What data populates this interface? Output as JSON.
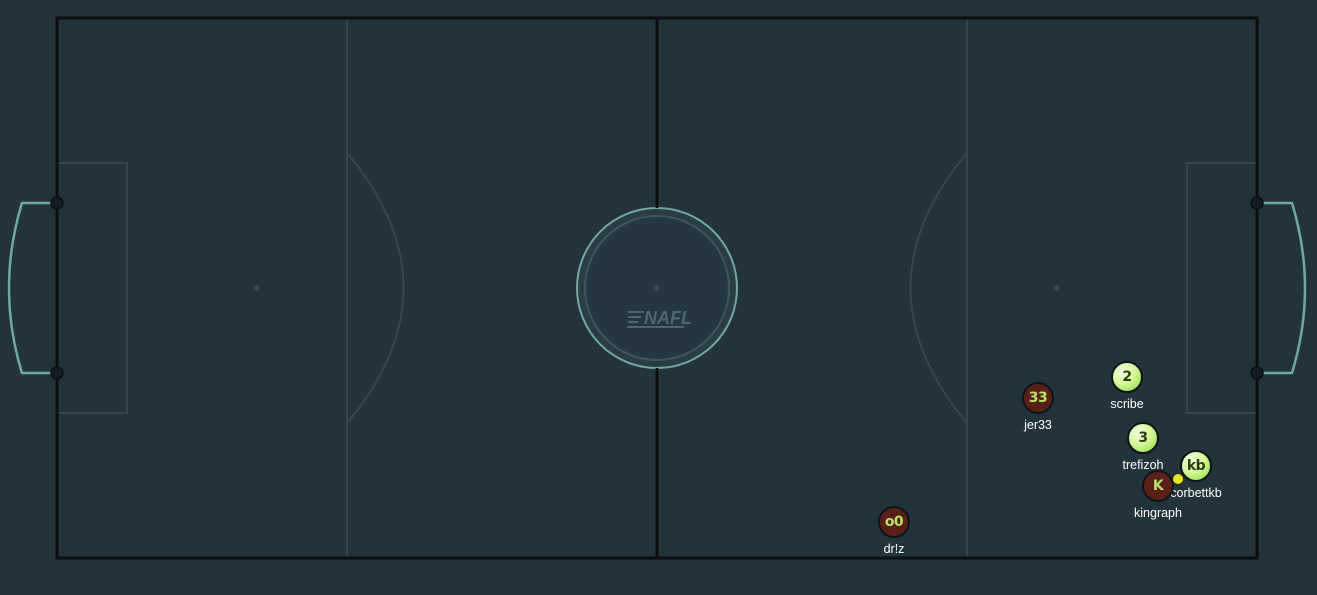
{
  "field": {
    "background_color": "#22333b",
    "line_color": "#2f434c",
    "border_color": "#0b0f12",
    "goal_color": "#6fa8a6",
    "logo_text": "NAFL"
  },
  "players": [
    {
      "id": "jer33",
      "avatar": "33",
      "nickname": "jer33",
      "team": "red"
    },
    {
      "id": "scribe",
      "avatar": "2",
      "nickname": "scribe",
      "team": "green"
    },
    {
      "id": "trefizoh",
      "avatar": "3",
      "nickname": "trefizoh",
      "team": "green"
    },
    {
      "id": "corbettkb",
      "avatar": "kb",
      "nickname": "corbettkb",
      "team": "green"
    },
    {
      "id": "kingraph",
      "avatar": "K",
      "nickname": "kingraph",
      "team": "red"
    },
    {
      "id": "drlz",
      "avatar": "o0",
      "nickname": "dr!z",
      "team": "red"
    }
  ],
  "team_colors": {
    "red": "#5a1f16",
    "green": "#d8f89a"
  },
  "ball": {
    "color": "#e6e628"
  }
}
